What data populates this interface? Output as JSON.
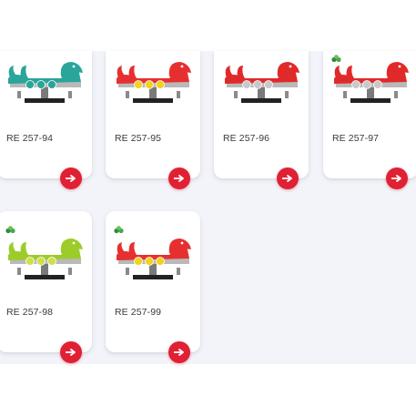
{
  "accent_color": "#e02133",
  "products": [
    {
      "code": "RE 257-94",
      "colors": {
        "body": "#2aa59a",
        "accent": "#2aa59a",
        "base": "#222222"
      },
      "eco_badge": false
    },
    {
      "code": "RE 257-95",
      "colors": {
        "body": "#e63030",
        "accent": "#f2d21c",
        "base": "#222222"
      },
      "eco_badge": false
    },
    {
      "code": "RE 257-96",
      "colors": {
        "body": "#e02a2a",
        "accent": "#c9c9c9",
        "base": "#222222"
      },
      "eco_badge": false
    },
    {
      "code": "RE 257-97",
      "colors": {
        "body": "#e02a2a",
        "accent": "#c9c9c9",
        "base": "#222222"
      },
      "eco_badge": true
    },
    {
      "code": "RE 257-98",
      "colors": {
        "body": "#9ccc2a",
        "accent": "#cfe04a",
        "base": "#222222"
      },
      "eco_badge": true
    },
    {
      "code": "RE 257-99",
      "colors": {
        "body": "#e63030",
        "accent": "#f2d21c",
        "base": "#222222"
      },
      "eco_badge": true
    }
  ],
  "icons": {
    "arrow": "arrow-right-icon",
    "eco": "recycle-leaf-icon"
  }
}
